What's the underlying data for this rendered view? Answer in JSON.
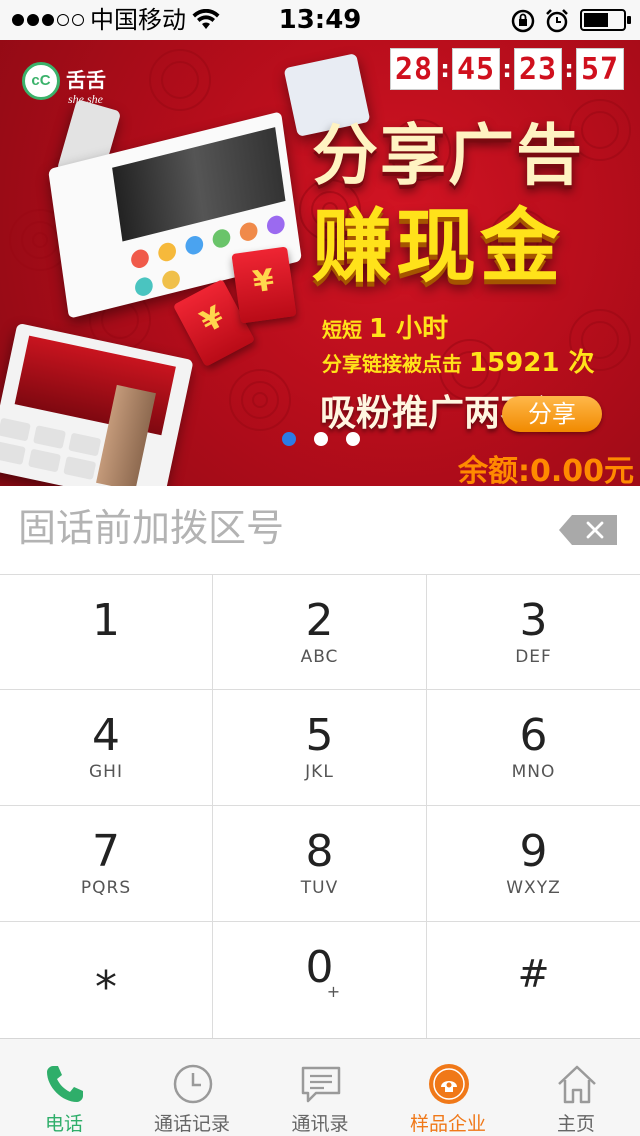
{
  "status_bar": {
    "carrier": "中国移动",
    "time": "13:49",
    "signal_bars_filled": 3,
    "signal_bars_total": 5
  },
  "banner": {
    "logo_text": "舌舌",
    "logo_sub": "she she",
    "logo_mark": "cC",
    "countdown": [
      "28",
      "45",
      "23",
      "57"
    ],
    "countdown_separator": ":",
    "headline_1": "分享广告",
    "headline_2": "赚现金",
    "line_1_prefix": "短短 ",
    "line_1_value": "1 小时",
    "line_2_prefix": "分享链接被点击 ",
    "line_2_value": "15921 次",
    "line_3": "吸粉推广两不误",
    "share_button": "分享",
    "balance": "余额:0.00元",
    "envelope_symbol": "¥",
    "pager": {
      "count": 3,
      "active_index": 0
    }
  },
  "input": {
    "placeholder": "固话前加拨区号",
    "value": ""
  },
  "keypad": {
    "keys": [
      {
        "digit": "1",
        "letters": ""
      },
      {
        "digit": "2",
        "letters": "ABC"
      },
      {
        "digit": "3",
        "letters": "DEF"
      },
      {
        "digit": "4",
        "letters": "GHI"
      },
      {
        "digit": "5",
        "letters": "JKL"
      },
      {
        "digit": "6",
        "letters": "MNO"
      },
      {
        "digit": "7",
        "letters": "PQRS"
      },
      {
        "digit": "8",
        "letters": "TUV"
      },
      {
        "digit": "9",
        "letters": "WXYZ"
      },
      {
        "digit": "⁎",
        "letters": ""
      },
      {
        "digit": "0",
        "letters": "+"
      },
      {
        "digit": "#",
        "letters": ""
      }
    ]
  },
  "tab_bar": {
    "items": [
      {
        "label": "电话",
        "icon": "phone-icon",
        "active": true
      },
      {
        "label": "通话记录",
        "icon": "clock-icon",
        "active": false
      },
      {
        "label": "通讯录",
        "icon": "message-icon",
        "active": false
      },
      {
        "label": "样品企业",
        "icon": "enterprise-icon",
        "active": false
      },
      {
        "label": "主页",
        "icon": "home-icon",
        "active": false
      }
    ]
  },
  "colors": {
    "accent_green": "#2fae6a",
    "accent_orange": "#f07818",
    "banner_red": "#c2101e",
    "headline_yellow": "#ffe21a",
    "pager_active": "#2c7be5"
  }
}
